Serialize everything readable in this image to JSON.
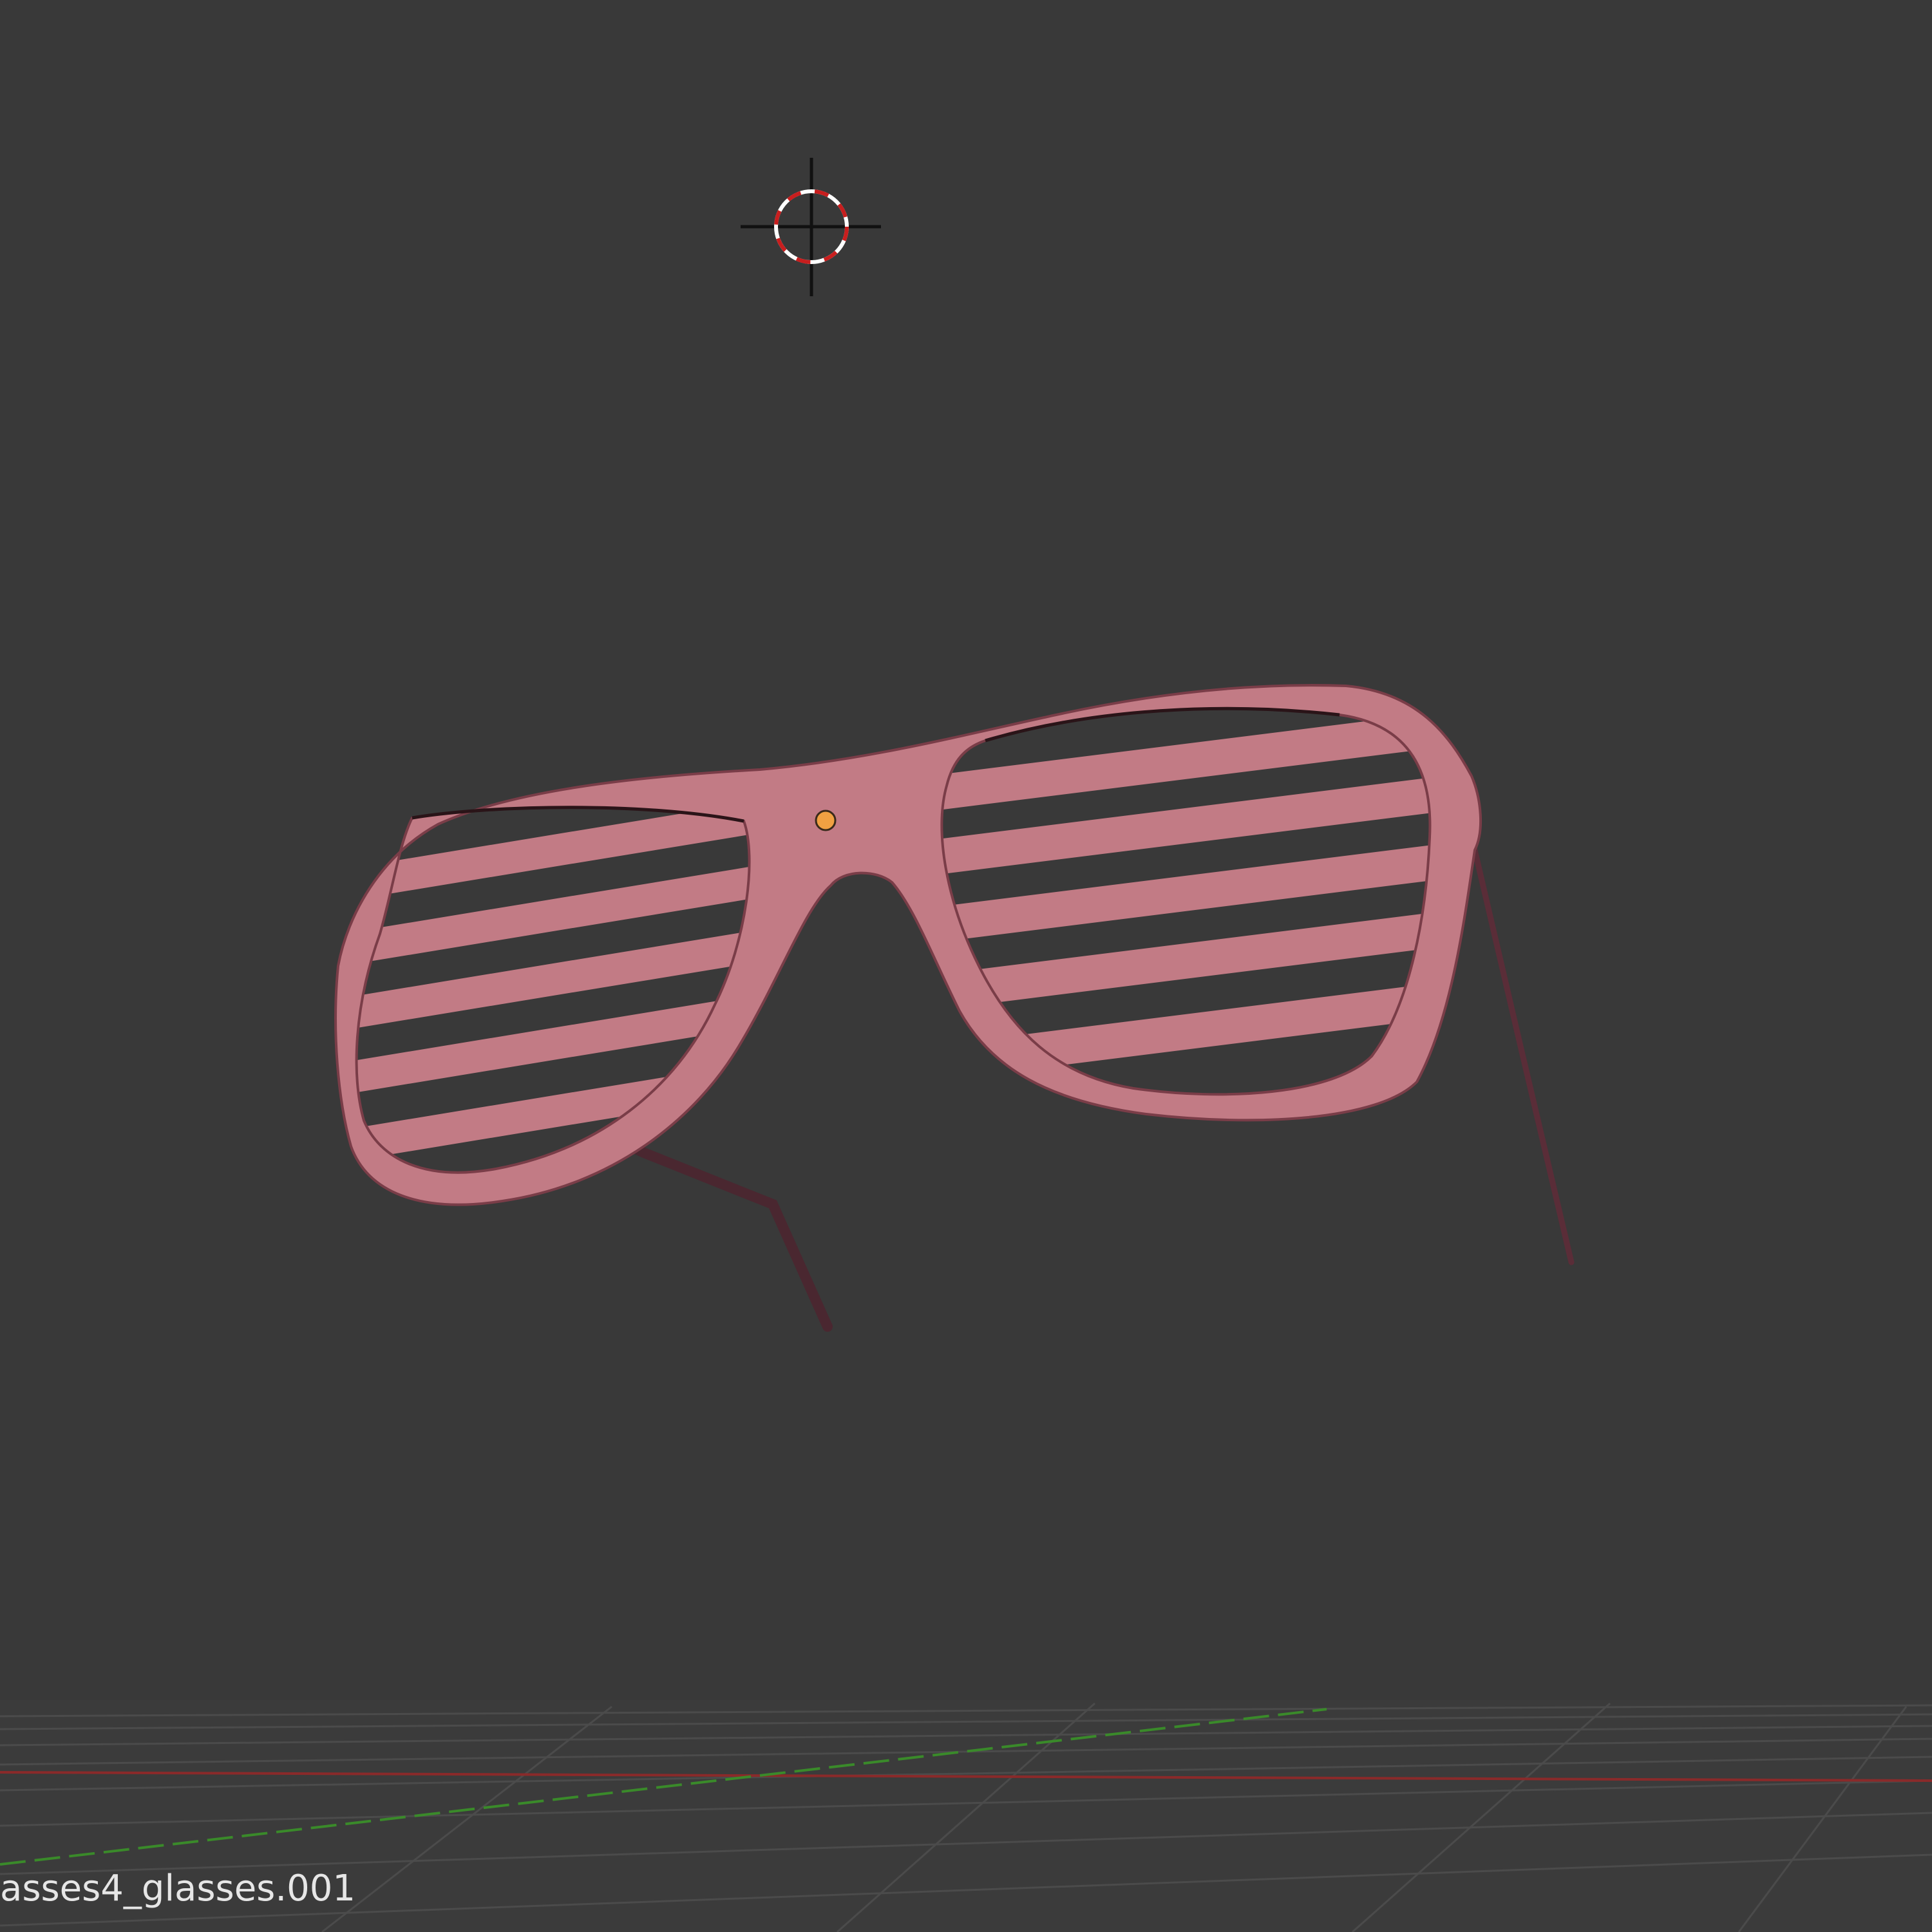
{
  "viewport": {
    "background_color": "#393939",
    "active_object_label": "asses4_glasses.001"
  },
  "scene": {
    "object_color": "#c27b85",
    "object_shadow_color": "#4a2730",
    "origin_color": "#f0a142",
    "grid_color": "#4a4a4a",
    "x_axis_color": "#8a2a2a",
    "y_axis_color": "#3a8a2a",
    "cursor_icon": "3d-cursor-icon"
  }
}
